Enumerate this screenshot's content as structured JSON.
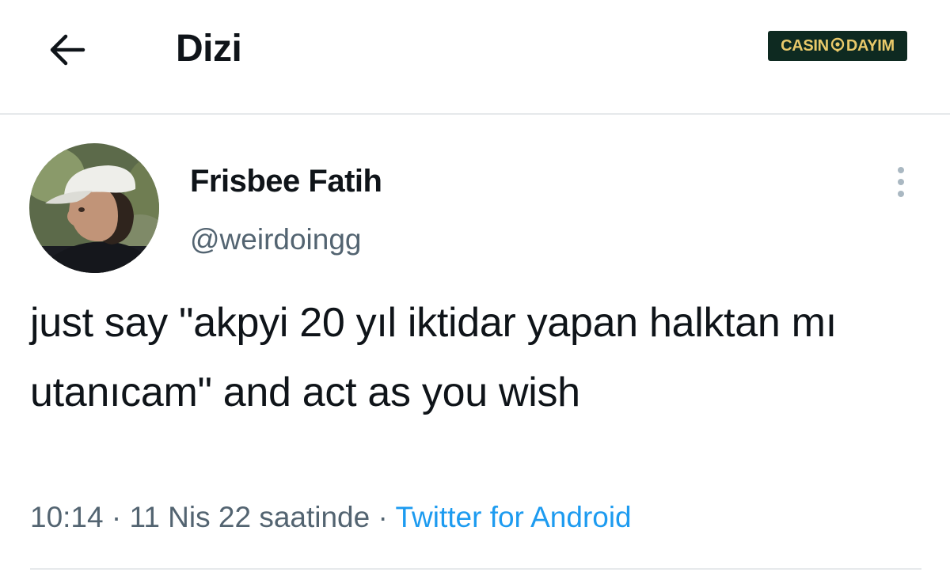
{
  "header": {
    "title": "Dizi",
    "back_icon": "arrow-left-icon"
  },
  "watermark": {
    "text_left": "CASIN",
    "text_right": "DAYIM",
    "background": "#0e2a21",
    "text_color": "#e9c96a"
  },
  "tweet": {
    "author": {
      "display_name": "Frisbee Fatih",
      "handle": "@weirdoingg",
      "avatar_icon": "profile-photo"
    },
    "more_icon": "more-vertical-icon",
    "text": "just say \"akpyi 20 yıl iktidar yapan halktan mı utanıcam\" and act as you wish",
    "meta": {
      "time": "10:14",
      "date": "11 Nis 22 saatinde",
      "separator": "·",
      "source": "Twitter for Android"
    }
  },
  "colors": {
    "text_primary": "#0f1419",
    "text_secondary": "#536471",
    "link": "#1d9bf0",
    "divider": "#e6e9eb"
  }
}
